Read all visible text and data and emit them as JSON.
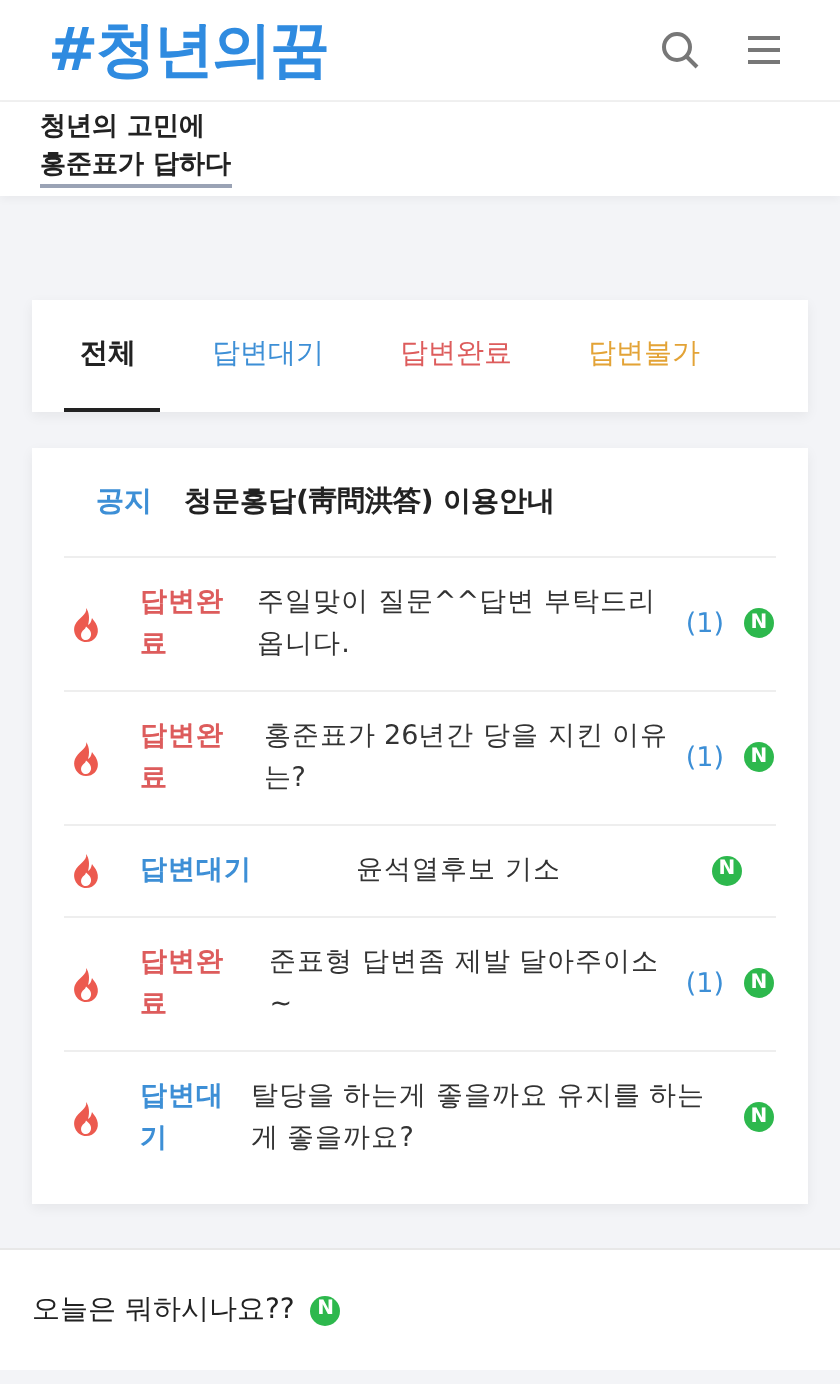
{
  "header": {
    "logo": "#청년의꿈"
  },
  "subtitle": {
    "line_1": "청년의 고민에",
    "line_2": "홍준표가 답하다"
  },
  "tabs": [
    {
      "label": "전체",
      "kind": "all",
      "selected": true
    },
    {
      "label": "답변대기",
      "kind": "waiting",
      "selected": false
    },
    {
      "label": "답변완료",
      "kind": "done",
      "selected": false
    },
    {
      "label": "답변불가",
      "kind": "rejected",
      "selected": false
    }
  ],
  "notice": {
    "tag": "공지",
    "title": "청문홍답(靑問洪答) 이용안내"
  },
  "posts": [
    {
      "status": "답변완료",
      "kind": "done",
      "title": "주일맞이 질문^^답변 부탁드리옵니다.",
      "comments": "(1)",
      "badge": "N"
    },
    {
      "status": "답변완료",
      "kind": "done",
      "title": "홍준표가 26년간 당을 지킨 이유는?",
      "comments": "(1)",
      "badge": "N"
    },
    {
      "status": "답변대기",
      "kind": "waiting",
      "title": "윤석열후보 기소",
      "badge": "N"
    },
    {
      "status": "답변완료",
      "kind": "done",
      "title": "준표형 답변좀 제발 달아주이소~",
      "comments": "(1)",
      "badge": "N"
    },
    {
      "status": "답변대기",
      "kind": "waiting",
      "title": "탈당을 하는게 좋을까요 유지를 하는게 좋을까요?",
      "badge": "N"
    }
  ],
  "footer_post": {
    "title": "오늘은 뭐하시나요??",
    "badge": "N"
  }
}
